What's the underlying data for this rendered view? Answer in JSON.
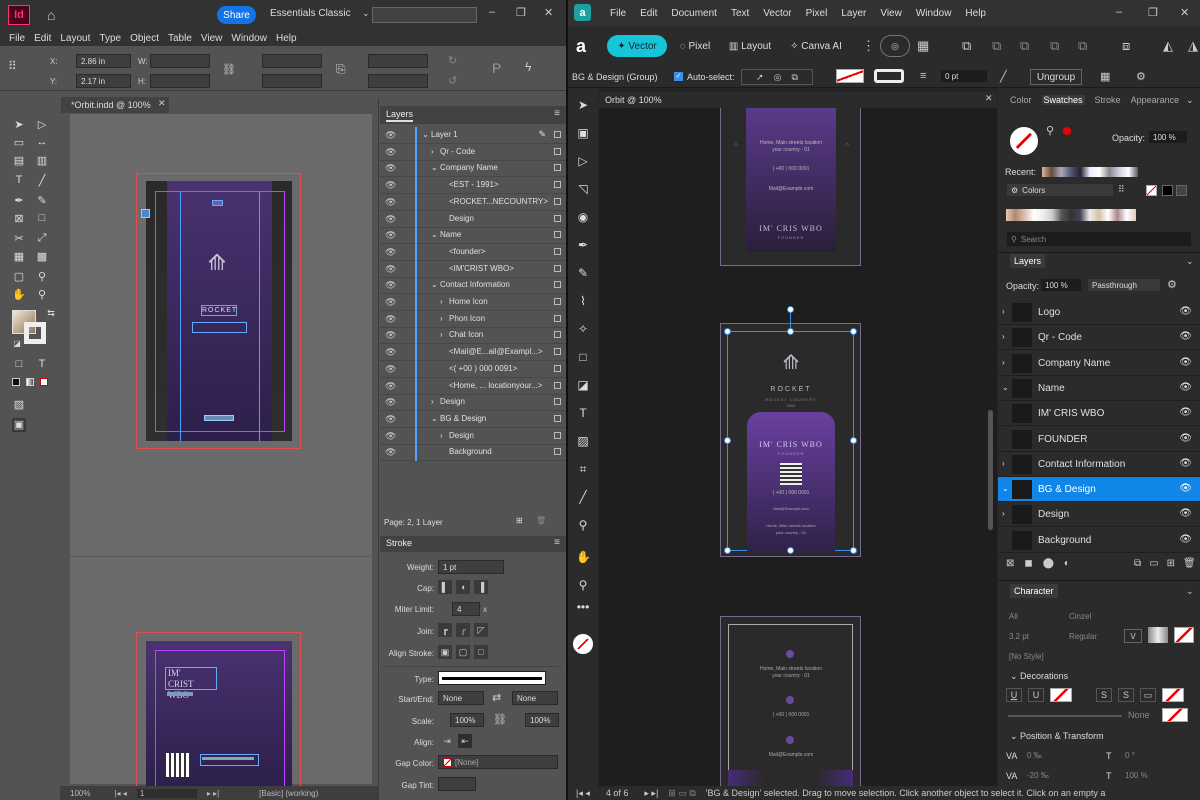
{
  "indesign": {
    "app_logo": "Id",
    "share_label": "Share",
    "workspace": "Essentials Classic",
    "menu": [
      "File",
      "Edit",
      "Layout",
      "Type",
      "Object",
      "Table",
      "View",
      "Window",
      "Help"
    ],
    "x_label": "X:",
    "x_value": "2.86 in",
    "y_label": "Y:",
    "y_value": "2.17 in",
    "w_label": "W:",
    "h_label": "H:",
    "doc_tab": "*Orbit.indd @ 100%",
    "zoom": "100%",
    "page_num": "1",
    "status": "[Basic] (working)",
    "layers_title": "Layers",
    "layers": [
      {
        "label": "Layer 1",
        "indent": 0,
        "arrow": "⌄"
      },
      {
        "label": "Qr - Code",
        "indent": 1,
        "arrow": "›"
      },
      {
        "label": "Company Name",
        "indent": 1,
        "arrow": "⌄"
      },
      {
        "label": "<EST - 1991>",
        "indent": 2,
        "arrow": ""
      },
      {
        "label": "<ROCKET...NECOUNTRY>",
        "indent": 2,
        "arrow": ""
      },
      {
        "label": "Design",
        "indent": 2,
        "arrow": ""
      },
      {
        "label": "Name",
        "indent": 1,
        "arrow": "⌄"
      },
      {
        "label": "<founder>",
        "indent": 2,
        "arrow": ""
      },
      {
        "label": "<IM'CRIST WBO>",
        "indent": 2,
        "arrow": ""
      },
      {
        "label": "Contact Information",
        "indent": 1,
        "arrow": "⌄"
      },
      {
        "label": "Home Icon",
        "indent": 2,
        "arrow": "›"
      },
      {
        "label": "Phon Icon",
        "indent": 2,
        "arrow": "›"
      },
      {
        "label": "Chat Icon",
        "indent": 2,
        "arrow": "›"
      },
      {
        "label": "<Mail@E...ail@Exampl...>",
        "indent": 2,
        "arrow": ""
      },
      {
        "label": "<( +00 ) 000 0091>",
        "indent": 2,
        "arrow": ""
      },
      {
        "label": "<Home, ... locationyour...>",
        "indent": 2,
        "arrow": ""
      },
      {
        "label": "Design",
        "indent": 1,
        "arrow": "›"
      },
      {
        "label": "BG & Design",
        "indent": 1,
        "arrow": "⌄"
      },
      {
        "label": "Design",
        "indent": 2,
        "arrow": "›"
      },
      {
        "label": "Background",
        "indent": 2,
        "arrow": ""
      }
    ],
    "layers_footer": "Page: 2, 1 Layer",
    "stroke_title": "Stroke",
    "stroke": {
      "weight_label": "Weight:",
      "weight": "1 pt",
      "cap_label": "Cap:",
      "miter_label": "Miter Limit:",
      "miter": "4",
      "miter_unit": "x",
      "join_label": "Join:",
      "align_label": "Align Stroke:",
      "type_label": "Type:",
      "startend_label": "Start/End:",
      "start": "None",
      "end": "None",
      "scale_label": "Scale:",
      "scale1": "100%",
      "scale2": "100%",
      "align2_label": "Align:",
      "gapcolor_label": "Gap Color:",
      "gapcolor": "[None]",
      "gaptint_label": "Gap Tint:"
    },
    "card1": {
      "brand": "ROCKET"
    },
    "card2": {
      "name_line1": "IM'",
      "name_line2": "CRIST WBO"
    }
  },
  "affinity": {
    "app_logo": "a",
    "menu": [
      "File",
      "Edit",
      "Document",
      "Text",
      "Vector",
      "Pixel",
      "Layer",
      "View",
      "Window",
      "Help"
    ],
    "personas": {
      "vector": "Vector",
      "pixel": "Pixel",
      "layout": "Layout",
      "canva": "Canva AI"
    },
    "selection_label": "BG & Design (Group)",
    "auto_select": "Auto-select:",
    "stroke_pt": "0 pt",
    "ungroup": "Ungroup",
    "doc_tab": "Orbit @ 100%",
    "card_top": {
      "line1": "Home, Main streets location",
      "line2": "your country - 01",
      "phone": "( +00 ) 000 0091",
      "mail": "Mail@Example.com",
      "name": "IM' CRIS WBO",
      "role": "FOUNDER"
    },
    "card_mid": {
      "brand": "ROCKET",
      "tag": "ROCKET COUNTRY",
      "year": "1991",
      "name": "IM' CRIS WBO",
      "role": "FOUNDER",
      "phone": "( +00 ) 000 0091",
      "mail": "Mail@Example.com",
      "addr1": "Home, Main streets location",
      "addr2": "your country - 01"
    },
    "card_bot": {
      "line1": "Home, Main streets location",
      "line2": "your country - 01",
      "phone": "( +00 ) 000 0091",
      "mail": "Mail@Example.com"
    },
    "right_tabs": [
      "Color",
      "Swatches",
      "Stroke",
      "Appearance"
    ],
    "opacity_label": "Opacity:",
    "opacity": "100 %",
    "recent_label": "Recent:",
    "palette": "Colors",
    "search_placeholder": "Search",
    "layers_tab": "Layers",
    "layer_opacity": "100 %",
    "blend": "Passthrough",
    "layers": [
      {
        "label": "Logo",
        "arrow": "›",
        "selected": false
      },
      {
        "label": "Qr - Code",
        "arrow": "›",
        "selected": false
      },
      {
        "label": "Company Name",
        "arrow": "›",
        "selected": false
      },
      {
        "label": "Name",
        "arrow": "⌄",
        "selected": false
      },
      {
        "label": "IM' CRIS WBO",
        "arrow": "",
        "selected": false
      },
      {
        "label": "FOUNDER",
        "arrow": "",
        "selected": false
      },
      {
        "label": "Contact Information",
        "arrow": "›",
        "selected": false
      },
      {
        "label": "BG & Design",
        "arrow": "⌄",
        "selected": true
      },
      {
        "label": "Design",
        "arrow": "›",
        "selected": false
      },
      {
        "label": "Background",
        "arrow": "",
        "selected": false
      }
    ],
    "character_tab": "Character",
    "char_all": "All",
    "font": "Cinzel",
    "size": "3.2 pt",
    "style": "Regular",
    "no_style": "[No Style]",
    "decorations": "Decorations",
    "none": "None",
    "pos_transform": "Position & Transform",
    "tracking1": "0 ‰",
    "rotation": "0 °",
    "tracking2": "-20 ‰",
    "scale": "100 %",
    "page_indicator": "4 of 6",
    "status_message": "'BG & Design' selected. Drag to move selection. Click another object to select it. Click on an empty area"
  }
}
